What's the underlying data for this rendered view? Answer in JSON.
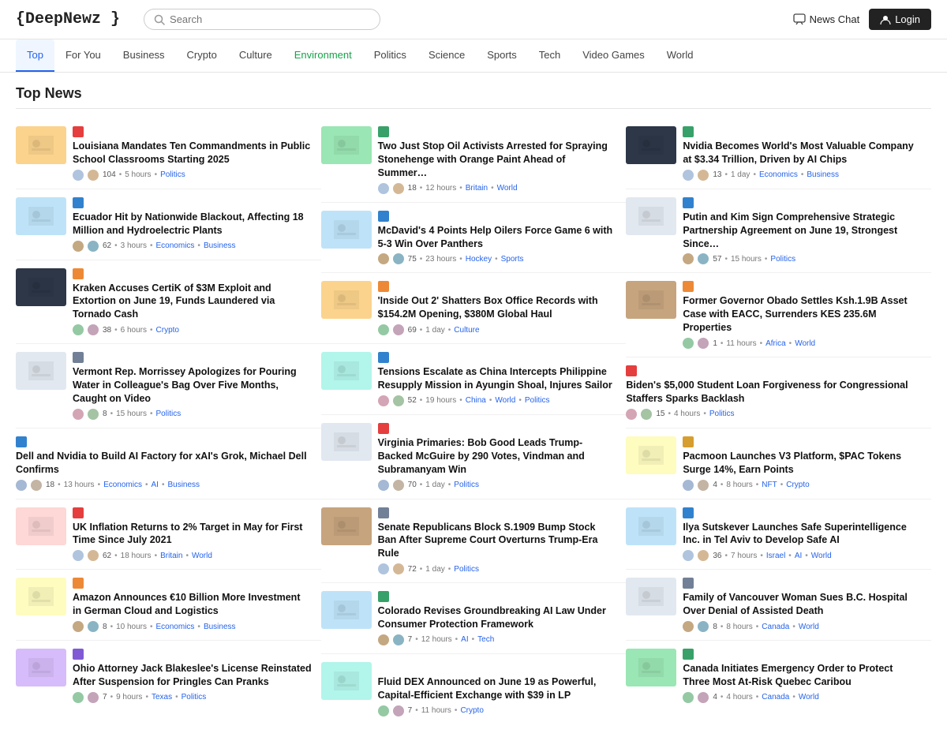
{
  "header": {
    "logo": "{DeepNewz }",
    "search_placeholder": "Search",
    "news_chat_label": "News Chat",
    "login_label": "Login"
  },
  "nav": {
    "items": [
      {
        "label": "Top",
        "active": true
      },
      {
        "label": "For You",
        "active": false
      },
      {
        "label": "Business",
        "active": false
      },
      {
        "label": "Crypto",
        "active": false
      },
      {
        "label": "Culture",
        "active": false
      },
      {
        "label": "Environment",
        "active": false
      },
      {
        "label": "Politics",
        "active": false
      },
      {
        "label": "Science",
        "active": false
      },
      {
        "label": "Sports",
        "active": false
      },
      {
        "label": "Tech",
        "active": false
      },
      {
        "label": "Video Games",
        "active": false
      },
      {
        "label": "World",
        "active": false
      }
    ]
  },
  "section_title": "Top News",
  "columns": [
    {
      "items": [
        {
          "title": "Louisiana Mandates Ten Commandments in Public School Classrooms Starting 2025",
          "time": "5 hours",
          "tags": [
            "Politics"
          ],
          "count": "104",
          "has_thumb": true,
          "thumb_color": "thumb-orange",
          "dot_color": "dot-red"
        },
        {
          "title": "Ecuador Hit by Nationwide Blackout, Affecting 18 Million and Hydroelectric Plants",
          "time": "3 hours",
          "tags": [
            "Economics",
            "Business"
          ],
          "count": "62",
          "has_thumb": true,
          "thumb_color": "thumb-blue",
          "dot_color": "dot-blue"
        },
        {
          "title": "Kraken Accuses CertiK of $3M Exploit and Extortion on June 19, Funds Laundered via Tornado Cash",
          "time": "6 hours",
          "tags": [
            "Crypto"
          ],
          "count": "38",
          "has_thumb": true,
          "thumb_color": "thumb-dark",
          "dot_color": "dot-orange"
        },
        {
          "title": "Vermont Rep. Morrissey Apologizes for Pouring Water in Colleague's Bag Over Five Months, Caught on Video",
          "time": "15 hours",
          "tags": [
            "Politics"
          ],
          "count": "8",
          "has_thumb": true,
          "thumb_color": "thumb-gray",
          "dot_color": "dot-gray"
        },
        {
          "title": "Dell and Nvidia to Build AI Factory for xAI's Grok, Michael Dell Confirms",
          "time": "13 hours",
          "tags": [
            "Economics",
            "AI",
            "Business"
          ],
          "count": "18",
          "has_thumb": false,
          "thumb_color": "",
          "dot_color": "dot-blue"
        },
        {
          "title": "UK Inflation Returns to 2% Target in May for First Time Since July 2021",
          "time": "18 hours",
          "tags": [
            "Britain",
            "World"
          ],
          "count": "62",
          "has_thumb": true,
          "thumb_color": "thumb-red",
          "dot_color": "dot-red"
        },
        {
          "title": "Amazon Announces €10 Billion More Investment in German Cloud and Logistics",
          "time": "10 hours",
          "tags": [
            "Economics",
            "Business"
          ],
          "count": "8",
          "has_thumb": true,
          "thumb_color": "thumb-yellow",
          "dot_color": "dot-orange"
        },
        {
          "title": "Ohio Attorney Jack Blakeslee's License Reinstated After Suspension for Pringles Can Pranks",
          "time": "9 hours",
          "tags": [
            "Texas",
            "Politics"
          ],
          "count": "7",
          "has_thumb": true,
          "thumb_color": "thumb-purple",
          "dot_color": "dot-purple"
        }
      ]
    },
    {
      "items": [
        {
          "title": "Two Just Stop Oil Activists Arrested for Spraying Stonehenge with Orange Paint Ahead of Summer…",
          "time": "12 hours",
          "tags": [
            "Britain",
            "World"
          ],
          "count": "18",
          "has_thumb": true,
          "thumb_color": "thumb-green",
          "dot_color": "dot-green"
        },
        {
          "title": "McDavid's 4 Points Help Oilers Force Game 6 with 5-3 Win Over Panthers",
          "time": "23 hours",
          "tags": [
            "Hockey",
            "Sports"
          ],
          "count": "75",
          "has_thumb": true,
          "thumb_color": "thumb-blue",
          "dot_color": "dot-blue"
        },
        {
          "title": "'Inside Out 2' Shatters Box Office Records with $154.2M Opening, $380M Global Haul",
          "time": "1 day",
          "tags": [
            "Culture"
          ],
          "count": "69",
          "has_thumb": true,
          "thumb_color": "thumb-orange",
          "dot_color": "dot-orange"
        },
        {
          "title": "Tensions Escalate as China Intercepts Philippine Resupply Mission in Ayungin Shoal, Injures Sailor",
          "time": "19 hours",
          "tags": [
            "China",
            "World",
            "Politics"
          ],
          "count": "52",
          "has_thumb": true,
          "thumb_color": "thumb-teal",
          "dot_color": "dot-blue"
        },
        {
          "title": "Virginia Primaries: Bob Good Leads Trump-Backed McGuire by 290 Votes, Vindman and Subramanyam Win",
          "time": "1 day",
          "tags": [
            "Politics"
          ],
          "count": "70",
          "has_thumb": true,
          "thumb_color": "thumb-gray",
          "dot_color": "dot-red"
        },
        {
          "title": "Senate Republicans Block S.1909 Bump Stock Ban After Supreme Court Overturns Trump-Era Rule",
          "time": "1 day",
          "tags": [
            "Politics"
          ],
          "count": "72",
          "has_thumb": true,
          "thumb_color": "thumb-brown",
          "dot_color": "dot-gray"
        },
        {
          "title": "Colorado Revises Groundbreaking AI Law Under Consumer Protection Framework",
          "time": "12 hours",
          "tags": [
            "AI",
            "Tech"
          ],
          "count": "7",
          "has_thumb": true,
          "thumb_color": "thumb-blue",
          "dot_color": "dot-green"
        },
        {
          "title": "Fluid DEX Announced on June 19 as Powerful, Capital-Efficient Exchange with $39 in LP",
          "time": "11 hours",
          "tags": [
            "Crypto"
          ],
          "count": "7",
          "has_thumb": true,
          "thumb_color": "thumb-teal",
          "dot_color": "dot-teal"
        }
      ]
    },
    {
      "items": [
        {
          "title": "Nvidia Becomes World's Most Valuable Company at $3.34 Trillion, Driven by AI Chips",
          "time": "1 day",
          "tags": [
            "Economics",
            "Business"
          ],
          "count": "13",
          "has_thumb": true,
          "thumb_color": "thumb-dark",
          "dot_color": "dot-green"
        },
        {
          "title": "Putin and Kim Sign Comprehensive Strategic Partnership Agreement on June 19, Strongest Since…",
          "time": "15 hours",
          "tags": [
            "Politics"
          ],
          "count": "57",
          "has_thumb": true,
          "thumb_color": "thumb-gray",
          "dot_color": "dot-blue"
        },
        {
          "title": "Former Governor Obado Settles Ksh.1.9B Asset Case with EACC, Surrenders KES 235.6M Properties",
          "time": "11 hours",
          "tags": [
            "Africa",
            "World"
          ],
          "count": "1",
          "has_thumb": true,
          "thumb_color": "thumb-brown",
          "dot_color": "dot-orange"
        },
        {
          "title": "Biden's $5,000 Student Loan Forgiveness for Congressional Staffers Sparks Backlash",
          "time": "4 hours",
          "tags": [
            "Politics"
          ],
          "count": "15",
          "has_thumb": false,
          "thumb_color": "",
          "dot_color": "dot-red"
        },
        {
          "title": "Pacmoon Launches V3 Platform, $PAC Tokens Surge 14%, Earn Points",
          "time": "8 hours",
          "tags": [
            "NFT",
            "Crypto"
          ],
          "count": "4",
          "has_thumb": true,
          "thumb_color": "thumb-yellow",
          "dot_color": "dot-yellow"
        },
        {
          "title": "Ilya Sutskever Launches Safe Superintelligence Inc. in Tel Aviv to Develop Safe AI",
          "time": "7 hours",
          "tags": [
            "Israel",
            "AI",
            "World"
          ],
          "count": "36",
          "has_thumb": true,
          "thumb_color": "thumb-blue",
          "dot_color": "dot-blue"
        },
        {
          "title": "Family of Vancouver Woman Sues B.C. Hospital Over Denial of Assisted Death",
          "time": "8 hours",
          "tags": [
            "Canada",
            "World"
          ],
          "count": "8",
          "has_thumb": true,
          "thumb_color": "thumb-gray",
          "dot_color": "dot-gray"
        },
        {
          "title": "Canada Initiates Emergency Order to Protect Three Most At-Risk Quebec Caribou",
          "time": "4 hours",
          "tags": [
            "Canada",
            "World"
          ],
          "count": "4",
          "has_thumb": true,
          "thumb_color": "thumb-green",
          "dot_color": "dot-green"
        }
      ]
    }
  ]
}
